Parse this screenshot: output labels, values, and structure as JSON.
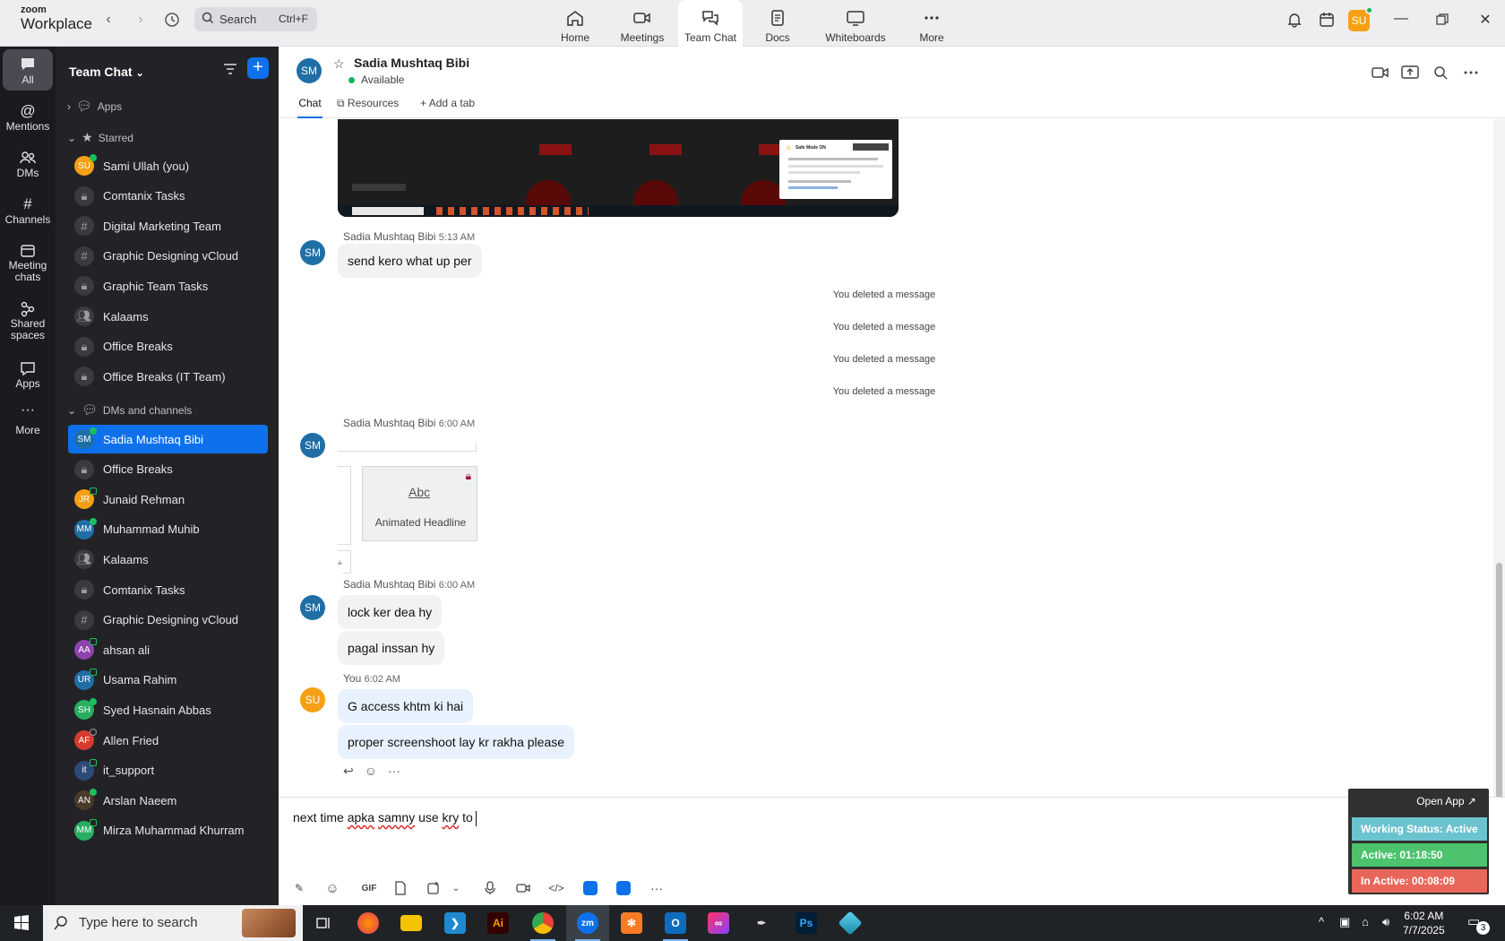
{
  "app": {
    "brand_small": "zoom",
    "brand_big": "Workplace"
  },
  "search": {
    "placeholder": "Search",
    "shortcut": "Ctrl+F"
  },
  "nav_tabs": [
    {
      "label": "Home",
      "icon": "home-icon"
    },
    {
      "label": "Meetings",
      "icon": "video-camera-icon"
    },
    {
      "label": "Team Chat",
      "icon": "chat-bubbles-icon"
    },
    {
      "label": "Docs",
      "icon": "document-icon"
    },
    {
      "label": "Whiteboards",
      "icon": "whiteboard-icon"
    },
    {
      "label": "More",
      "icon": "ellipsis-icon"
    }
  ],
  "user": {
    "initials": "SU",
    "color": "#f5a014"
  },
  "rail": [
    {
      "label": "All"
    },
    {
      "label": "Mentions"
    },
    {
      "label": "DMs"
    },
    {
      "label": "Channels"
    },
    {
      "label": "Meeting chats"
    },
    {
      "label": "Shared spaces"
    },
    {
      "label": "Apps"
    },
    {
      "label": "More"
    }
  ],
  "sidebar": {
    "title": "Team Chat",
    "sections": {
      "apps": "Apps",
      "starred": "Starred",
      "dms": "DMs and channels"
    },
    "starred": [
      {
        "name": "Sami Ullah (you)",
        "type": "user",
        "initials": "SU",
        "color": "#f5a014"
      },
      {
        "name": "Comtanix Tasks",
        "type": "lock"
      },
      {
        "name": "Digital Marketing Team",
        "type": "hash"
      },
      {
        "name": "Graphic Designing vCloud",
        "type": "hash"
      },
      {
        "name": "Graphic Team Tasks",
        "type": "lock"
      },
      {
        "name": "Kalaams",
        "type": "group"
      },
      {
        "name": "Office Breaks",
        "type": "lock"
      },
      {
        "name": "Office Breaks (IT Team)",
        "type": "lock"
      }
    ],
    "dms": [
      {
        "name": "Sadia Mushtaq Bibi",
        "type": "user",
        "initials": "SM",
        "color": "#1f6fa6"
      },
      {
        "name": "Office Breaks",
        "type": "lock"
      },
      {
        "name": "Junaid Rehman",
        "type": "user",
        "initials": "JR",
        "color": "#f5a014"
      },
      {
        "name": "Muhammad Muhib",
        "type": "user",
        "initials": "MM",
        "color": "#1f6fa6"
      },
      {
        "name": "Kalaams",
        "type": "group"
      },
      {
        "name": "Comtanix Tasks",
        "type": "lock"
      },
      {
        "name": "Graphic Designing vCloud",
        "type": "hash"
      },
      {
        "name": "ahsan ali",
        "type": "user",
        "initials": "AA",
        "color": "#8e44ad"
      },
      {
        "name": "Usama Rahim",
        "type": "user",
        "initials": "UR",
        "color": "#1f6fa6"
      },
      {
        "name": "Syed Hasnain Abbas",
        "type": "user",
        "initials": "SH",
        "color": "#27ae60"
      },
      {
        "name": "Allen Fried",
        "type": "user",
        "initials": "AF",
        "color": "#d63b2f"
      },
      {
        "name": "it_support",
        "type": "user",
        "initials": "it",
        "color": "#2c4a7a"
      },
      {
        "name": "Arslan Naeem",
        "type": "user",
        "initials": "AN",
        "color": "#4a3a2a"
      },
      {
        "name": "Mirza Muhammad Khurram",
        "type": "user",
        "initials": "MM",
        "color": "#27ae60"
      }
    ]
  },
  "chat": {
    "name": "Sadia Mushtaq Bibi",
    "initials": "SM",
    "status": "Available",
    "tabs": [
      "Chat",
      "Resources",
      "Add a tab"
    ],
    "messages": {
      "m1_sender": "Sadia Mushtaq Bibi",
      "m1_time": "5:13 AM",
      "m1_text": "send kero what up per",
      "deleted": "You deleted a message",
      "m2_sender": "Sadia Mushtaq Bibi",
      "m2_time": "6:00 AM",
      "card_label": "Animated Headline",
      "card_glyph": "Abc",
      "m3_sender": "Sadia Mushtaq Bibi",
      "m3_time": "6:00 AM",
      "m3_text1": "lock ker dea hy",
      "m3_text2": "pagal inssan hy",
      "m4_sender": "You",
      "m4_time": "6:02 AM",
      "m4_text1": "G access khtm ki hai",
      "m4_text2": "proper screenshoot lay kr rakha please"
    },
    "screenshot_popup": {
      "title": "Safe Mode ON"
    },
    "composer": {
      "w1": "next time",
      "w2": "apka",
      "w3": "samny",
      "w4": "use",
      "w5": "kry",
      "w6": "to"
    }
  },
  "widget": {
    "open": "Open App ↗",
    "working": "Working Status: Active",
    "active": "Active: 01:18:50",
    "inactive": "In Active: 00:08:09",
    "colors": {
      "working": "#6cc3d0",
      "active": "#4cc36c",
      "inactive": "#e8675a"
    }
  },
  "taskbar": {
    "search": "Type here to search",
    "time": "6:02 AM",
    "date": "7/7/2025",
    "notifications": "3"
  }
}
